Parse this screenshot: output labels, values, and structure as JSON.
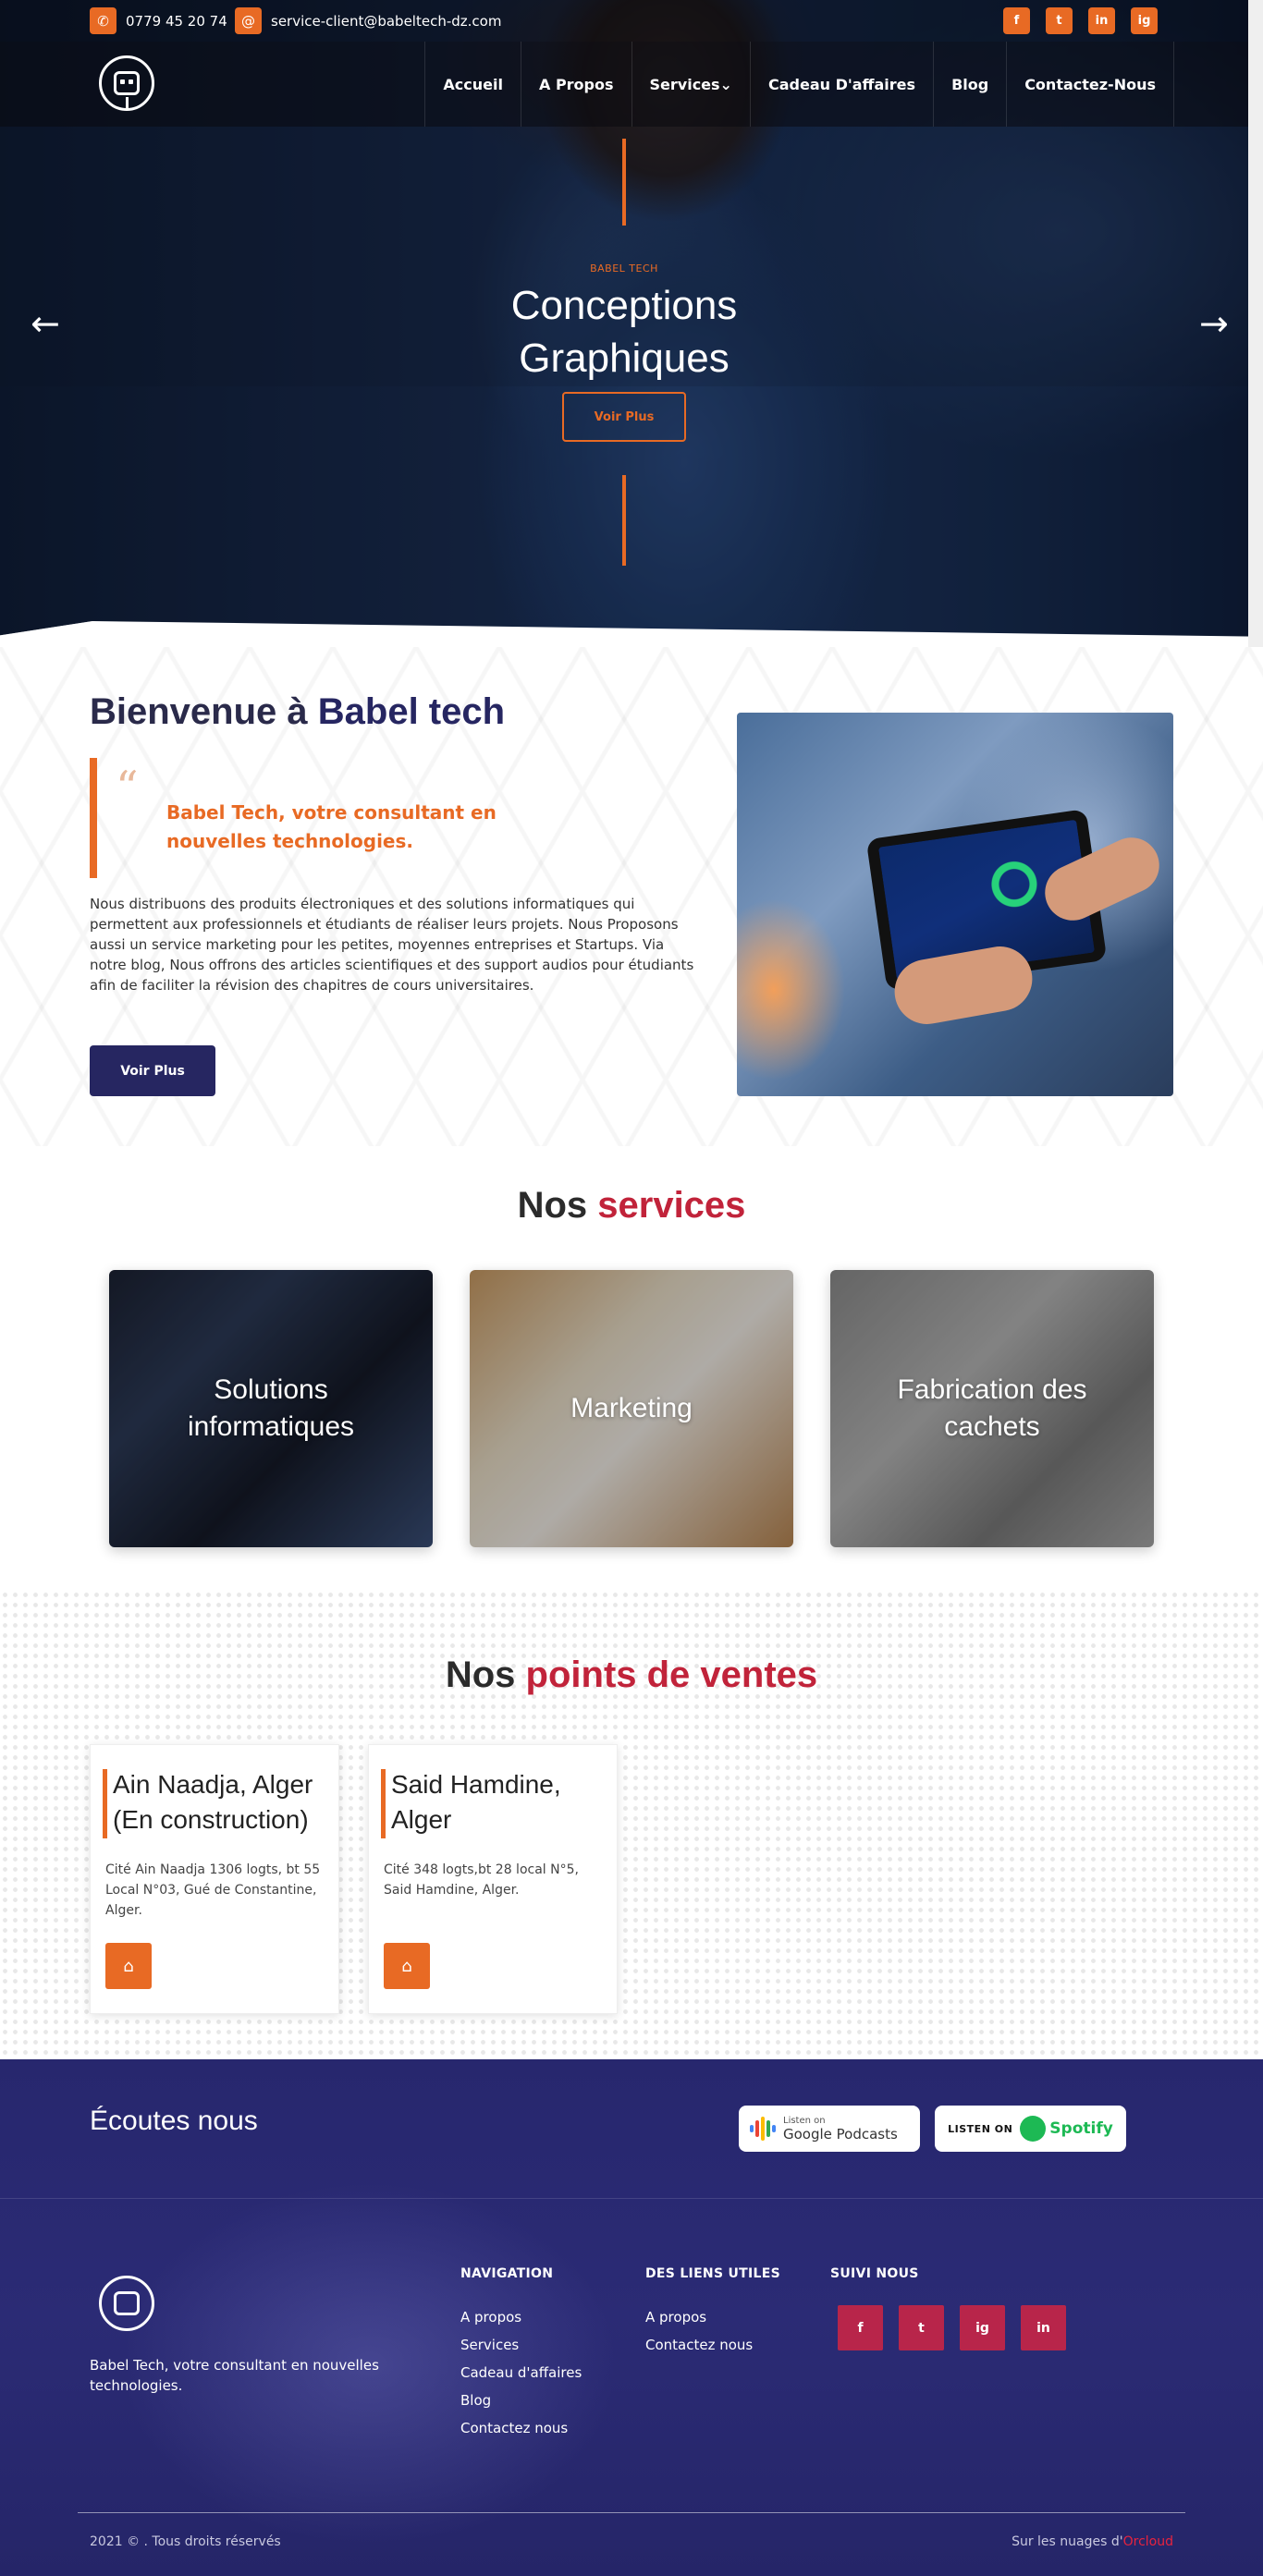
{
  "topbar": {
    "phone": "0779 45 20 74",
    "email": "service-client@babeltech-dz.com",
    "social": [
      "f",
      "t",
      "in",
      "ig"
    ]
  },
  "nav": {
    "items": [
      "Accueil",
      "A Propos",
      "Services⌄",
      "Cadeau D'affaires",
      "Blog",
      "Contactez-Nous"
    ]
  },
  "hero": {
    "kicker": "BABEL TECH",
    "title": "Conceptions Graphiques",
    "button": "Voir Plus",
    "prev": "←",
    "next": "→"
  },
  "welcome": {
    "title_prefix": "Bienvenue à ",
    "title_accent": "Babel tech",
    "quote_mark": "“",
    "quote": "Babel Tech, votre consultant en nouvelles technologies.",
    "paragraph": "Nous distribuons des produits électroniques et des solutions informatiques qui permettent aux professionnels et étudiants de réaliser leurs projets. Nous Proposons aussi un service marketing pour les petites, moyennes entreprises et Startups. Via notre blog, Nous offrons des articles scientifiques et des support audios pour étudiants afin de faciliter la révision des chapitres de cours universitaires.",
    "button": "Voir Plus"
  },
  "services": {
    "title_prefix": "Nos ",
    "title_accent": "services",
    "items": [
      "Solutions informatiques",
      "Marketing",
      "Fabrication des cachets"
    ]
  },
  "points": {
    "title_prefix": "Nos ",
    "title_accent": "points de ventes",
    "items": [
      {
        "title": "Ain Naadja, Alger (En construction)",
        "address": "Cité Ain Naadja 1306 logts, bt 55 Local N°03, Gué de Constantine, Alger."
      },
      {
        "title": "Said Hamdine, Alger",
        "address": "Cité 348 logts,bt 28 local N°5, Said Hamdine, Alger."
      }
    ]
  },
  "footer": {
    "listen": "Écoutes nous",
    "google_small": "Listen on",
    "google_big": "Google Podcasts",
    "spotify_pre": "LISTEN ON",
    "spotify": "Spotify",
    "tagline": "Babel Tech, votre consultant en nouvelles technologies.",
    "nav_title": "NAVIGATION",
    "nav_links": [
      "A propos",
      "Services",
      "Cadeau d'affaires",
      "Blog",
      "Contactez nous"
    ],
    "useful_title": "DES LIENS UTILES",
    "useful_links": [
      "A propos",
      "Contactez nous"
    ],
    "follow_title": "SUIVI NOUS",
    "follow_icons": [
      "f",
      "t",
      "ig",
      "in"
    ],
    "copyright": "2021 © . Tous droits réservés",
    "credit_prefix": "Sur les nuages d'",
    "credit_brand": "Orcloud"
  },
  "colors": {
    "accent": "#e86a24",
    "navy": "#262661",
    "red": "#c1233a",
    "footer": "#2b2b75"
  }
}
